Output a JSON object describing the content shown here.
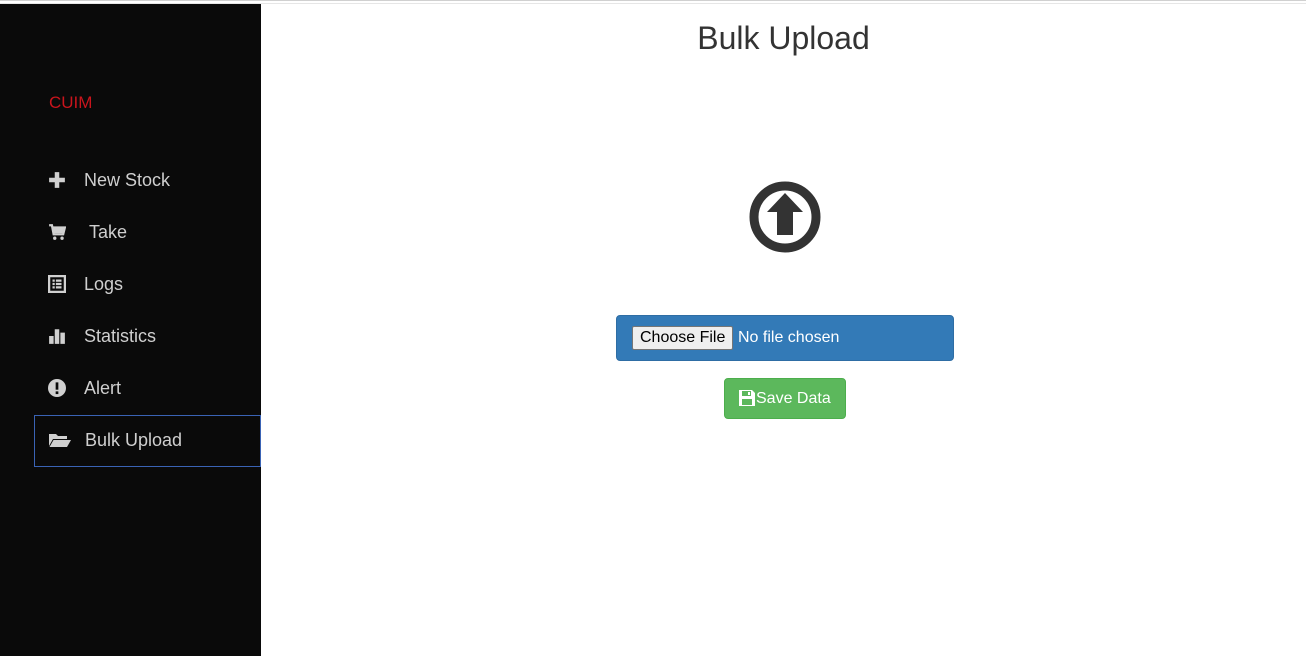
{
  "sidebar": {
    "brand": "CUIM",
    "items": [
      {
        "label": "New Stock",
        "icon": "plus-icon"
      },
      {
        "label": "Take",
        "icon": "cart-icon"
      },
      {
        "label": "Logs",
        "icon": "list-icon"
      },
      {
        "label": "Statistics",
        "icon": "bar-chart-icon"
      },
      {
        "label": "Alert",
        "icon": "exclamation-circle-icon"
      },
      {
        "label": "Bulk Upload",
        "icon": "folder-open-icon",
        "active": true
      }
    ]
  },
  "main": {
    "title": "Bulk Upload",
    "upload_icon": "upload-circle-icon",
    "file_input": {
      "button_label": "Choose File",
      "status": "No file chosen"
    },
    "save_button": {
      "label": "Save Data",
      "icon": "floppy-disk-icon"
    }
  },
  "colors": {
    "sidebar_bg": "#0a0a0a",
    "brand": "#c9141c",
    "active_border": "#3a63b5",
    "file_box_bg": "#337ab7",
    "save_bg": "#5cb85c"
  }
}
